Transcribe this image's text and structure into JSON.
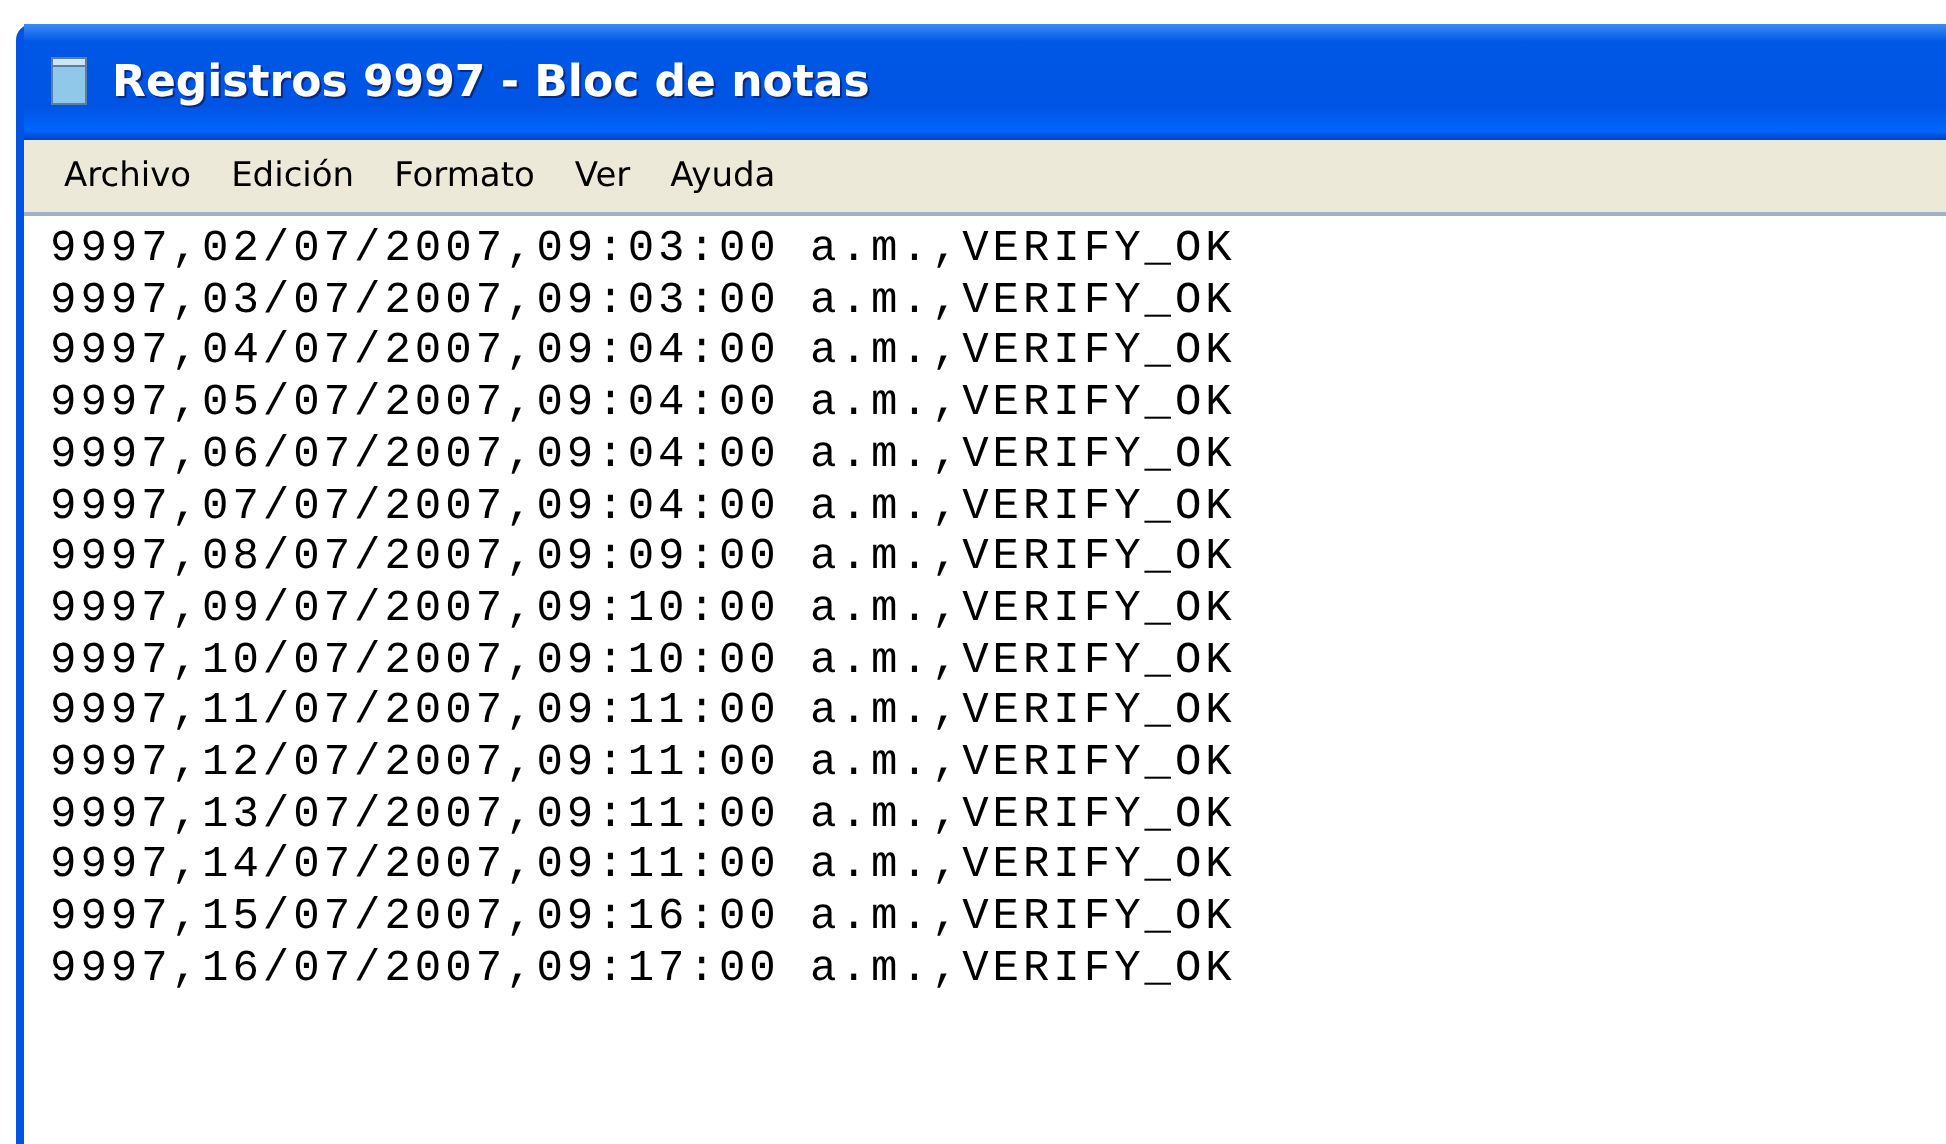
{
  "window": {
    "title": "Registros 9997 - Bloc de notas"
  },
  "menu": [
    "Archivo",
    "Edición",
    "Formato",
    "Ver",
    "Ayuda"
  ],
  "lines": [
    "9997,02/07/2007,09:03:00 a.m.,VERIFY_OK",
    "9997,03/07/2007,09:03:00 a.m.,VERIFY_OK",
    "9997,04/07/2007,09:04:00 a.m.,VERIFY_OK",
    "9997,05/07/2007,09:04:00 a.m.,VERIFY_OK",
    "9997,06/07/2007,09:04:00 a.m.,VERIFY_OK",
    "9997,07/07/2007,09:04:00 a.m.,VERIFY_OK",
    "9997,08/07/2007,09:09:00 a.m.,VERIFY_OK",
    "9997,09/07/2007,09:10:00 a.m.,VERIFY_OK",
    "9997,10/07/2007,09:10:00 a.m.,VERIFY_OK",
    "9997,11/07/2007,09:11:00 a.m.,VERIFY_OK",
    "9997,12/07/2007,09:11:00 a.m.,VERIFY_OK",
    "9997,13/07/2007,09:11:00 a.m.,VERIFY_OK",
    "9997,14/07/2007,09:11:00 a.m.,VERIFY_OK",
    "9997,15/07/2007,09:16:00 a.m.,VERIFY_OK",
    "9997,16/07/2007,09:17:00 a.m.,VERIFY_OK"
  ]
}
